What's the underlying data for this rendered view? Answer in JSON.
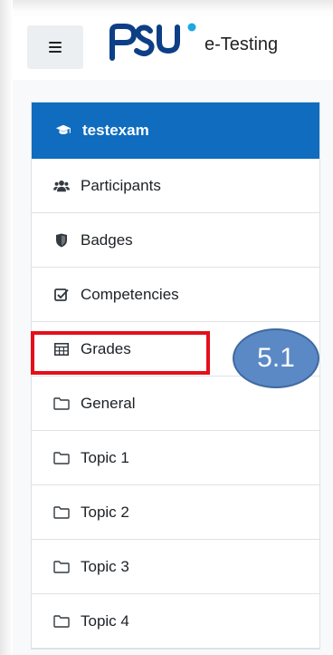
{
  "header": {
    "brand_text": "e-Testing",
    "logo_letters": "PSU",
    "accent": "#1ea7e1"
  },
  "sidebar": {
    "items": [
      {
        "label": "testexam",
        "icon": "graduation-cap-icon",
        "active": true
      },
      {
        "label": "Participants",
        "icon": "users-icon"
      },
      {
        "label": "Badges",
        "icon": "shield-icon"
      },
      {
        "label": "Competencies",
        "icon": "checkbox-icon"
      },
      {
        "label": "Grades",
        "icon": "table-icon"
      },
      {
        "label": "General",
        "icon": "folder-icon"
      },
      {
        "label": "Topic 1",
        "icon": "folder-icon"
      },
      {
        "label": "Topic 2",
        "icon": "folder-icon"
      },
      {
        "label": "Topic 3",
        "icon": "folder-icon"
      },
      {
        "label": "Topic 4",
        "icon": "folder-icon"
      }
    ]
  },
  "annotation": {
    "step_label": "5.1",
    "highlight_color": "#e3101a",
    "callout_color": "#5b89c5"
  },
  "colors": {
    "active_bg": "#0f6cbf"
  }
}
